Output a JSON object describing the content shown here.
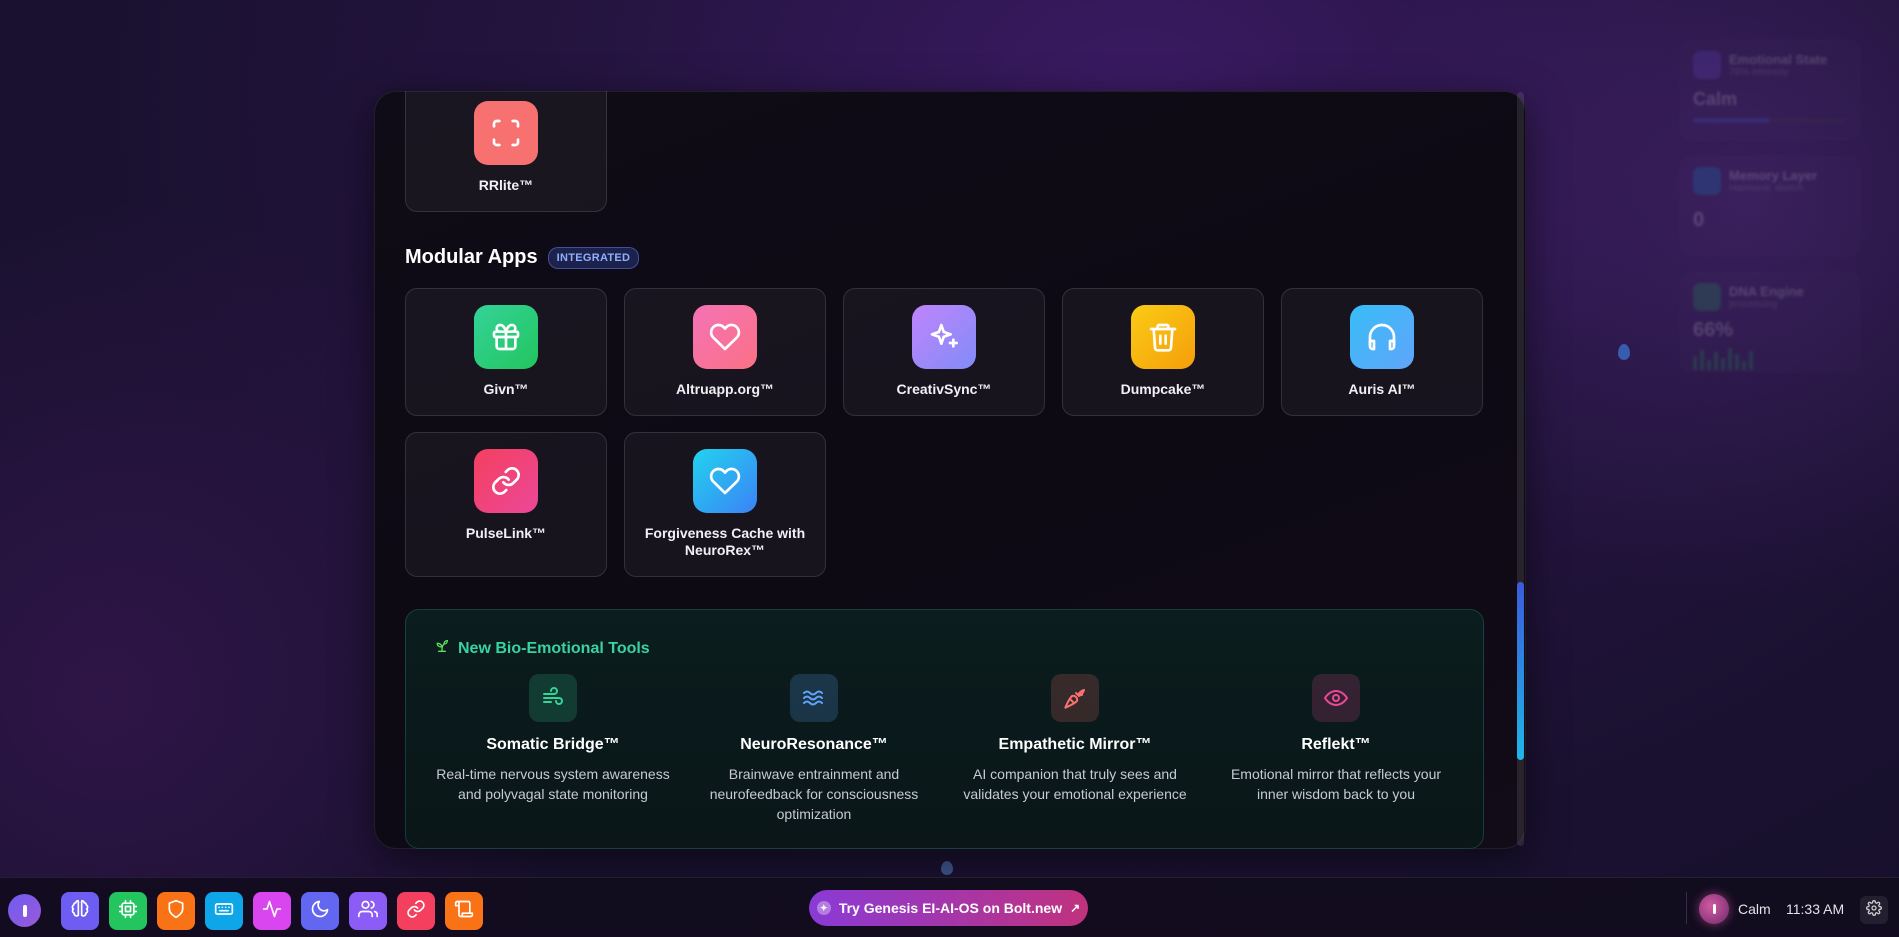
{
  "apps_top": [
    {
      "label": "RRlite™",
      "icon": "scan-icon",
      "color": "#f87171"
    }
  ],
  "modular": {
    "title": "Modular Apps",
    "badge": "INTEGRATED",
    "apps": [
      {
        "label": "Givn™",
        "icon": "gift-icon",
        "color": "#34d399"
      },
      {
        "label": "Altruapp.org™",
        "icon": "heart-icon",
        "color": "#f472b6"
      },
      {
        "label": "CreativSync™",
        "icon": "sparkles-icon",
        "color": "#a78bfa"
      },
      {
        "label": "Dumpcake™",
        "icon": "trash-icon",
        "color": "#facc15"
      },
      {
        "label": "Auris AI™",
        "icon": "headphones-icon",
        "color": "#38bdf8"
      },
      {
        "label": "PulseLink™",
        "icon": "link-icon",
        "color": "#f43f5e"
      },
      {
        "label": "Forgiveness Cache with NeuroRex™",
        "icon": "heart-icon",
        "color": "#22d3ee"
      }
    ]
  },
  "bio_tools": {
    "title": "New Bio-Emotional Tools",
    "tools": [
      {
        "name": "Somatic Bridge™",
        "desc": "Real-time nervous system awareness and polyvagal state monitoring",
        "icon": "wind-icon",
        "color": "#34d399"
      },
      {
        "name": "NeuroResonance™",
        "desc": "Brainwave entrainment and neurofeedback for consciousness optimization",
        "icon": "waves-icon",
        "color": "#60a5fa"
      },
      {
        "name": "Empathetic Mirror™",
        "desc": "AI companion that truly sees and validates your emotional experience",
        "icon": "carrot-icon",
        "color": "#f87171"
      },
      {
        "name": "Reflekt™",
        "desc": "Emotional mirror that reflects your inner wisdom back to you",
        "icon": "eye-icon",
        "color": "#ec4899"
      }
    ]
  },
  "side_widgets": [
    {
      "title": "Emotional State",
      "subtitle": "78% intensity",
      "value": "Calm"
    },
    {
      "title": "Memory Layer",
      "subtitle": "Harmonic sketch",
      "value": "0"
    },
    {
      "title": "DNA Engine",
      "subtitle": "processing",
      "value": "66%"
    }
  ],
  "taskbar": {
    "promo": "Try Genesis EI-AI-OS on Bolt.new",
    "mood": "Calm",
    "time": "11:33 AM",
    "apps": [
      {
        "icon": "brain-icon",
        "color": "#6d5df2"
      },
      {
        "icon": "cpu-icon",
        "color": "#22c55e"
      },
      {
        "icon": "shield-icon",
        "color": "#f97316"
      },
      {
        "icon": "keyboard-icon",
        "color": "#0ea5e9"
      },
      {
        "icon": "activity-icon",
        "color": "#d946ef"
      },
      {
        "icon": "moon-icon",
        "color": "#6366f1"
      },
      {
        "icon": "users-icon",
        "color": "#8b5cf6"
      },
      {
        "icon": "link-icon",
        "color": "#f43f5e"
      },
      {
        "icon": "scroll-icon",
        "color": "#f97316"
      }
    ]
  }
}
